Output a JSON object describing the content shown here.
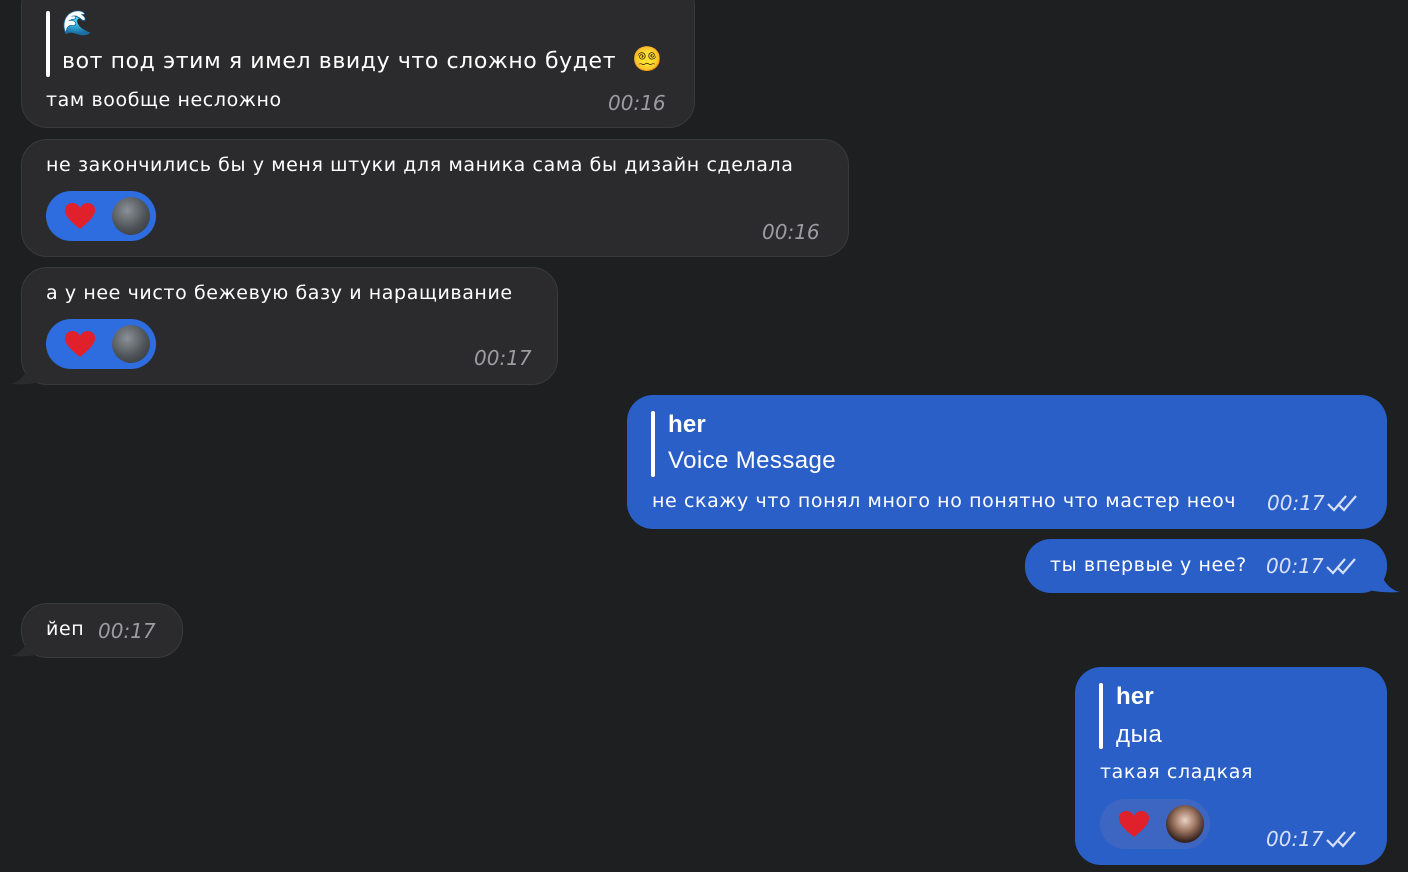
{
  "messages": {
    "m1": {
      "quote_emoji": "🌊",
      "quote_text": "вот под этим я имел ввиду что сложно будет",
      "quote_emoji2": "😵‍💫",
      "text": "там вообще несложно",
      "time": "00:16"
    },
    "m2": {
      "text": "не закончились бы у меня штуки для маника сама бы дизайн сделала",
      "time": "00:16",
      "reaction": "heart"
    },
    "m3": {
      "text": "а у нее чисто бежевую базу и наращивание",
      "time": "00:17",
      "reaction": "heart"
    },
    "m4": {
      "quote_author": "her",
      "quote_text": "Voice Message",
      "text": "не скажу что понял много но понятно что мастер неоч",
      "time": "00:17"
    },
    "m5": {
      "text": "ты впервые у нее?",
      "time": "00:17"
    },
    "m6": {
      "text": "йеп",
      "time": "00:17"
    },
    "m7": {
      "quote_author": "her",
      "quote_text": "дыа",
      "text": "такая сладкая",
      "time": "00:17",
      "reaction": "heart"
    }
  },
  "colors": {
    "background": "#1e1f21",
    "incoming_bubble": "#2b2b2d",
    "outgoing_bubble": "#2a5fc8",
    "reaction_pill": "#2e6de0",
    "heart": "#e0202a"
  }
}
